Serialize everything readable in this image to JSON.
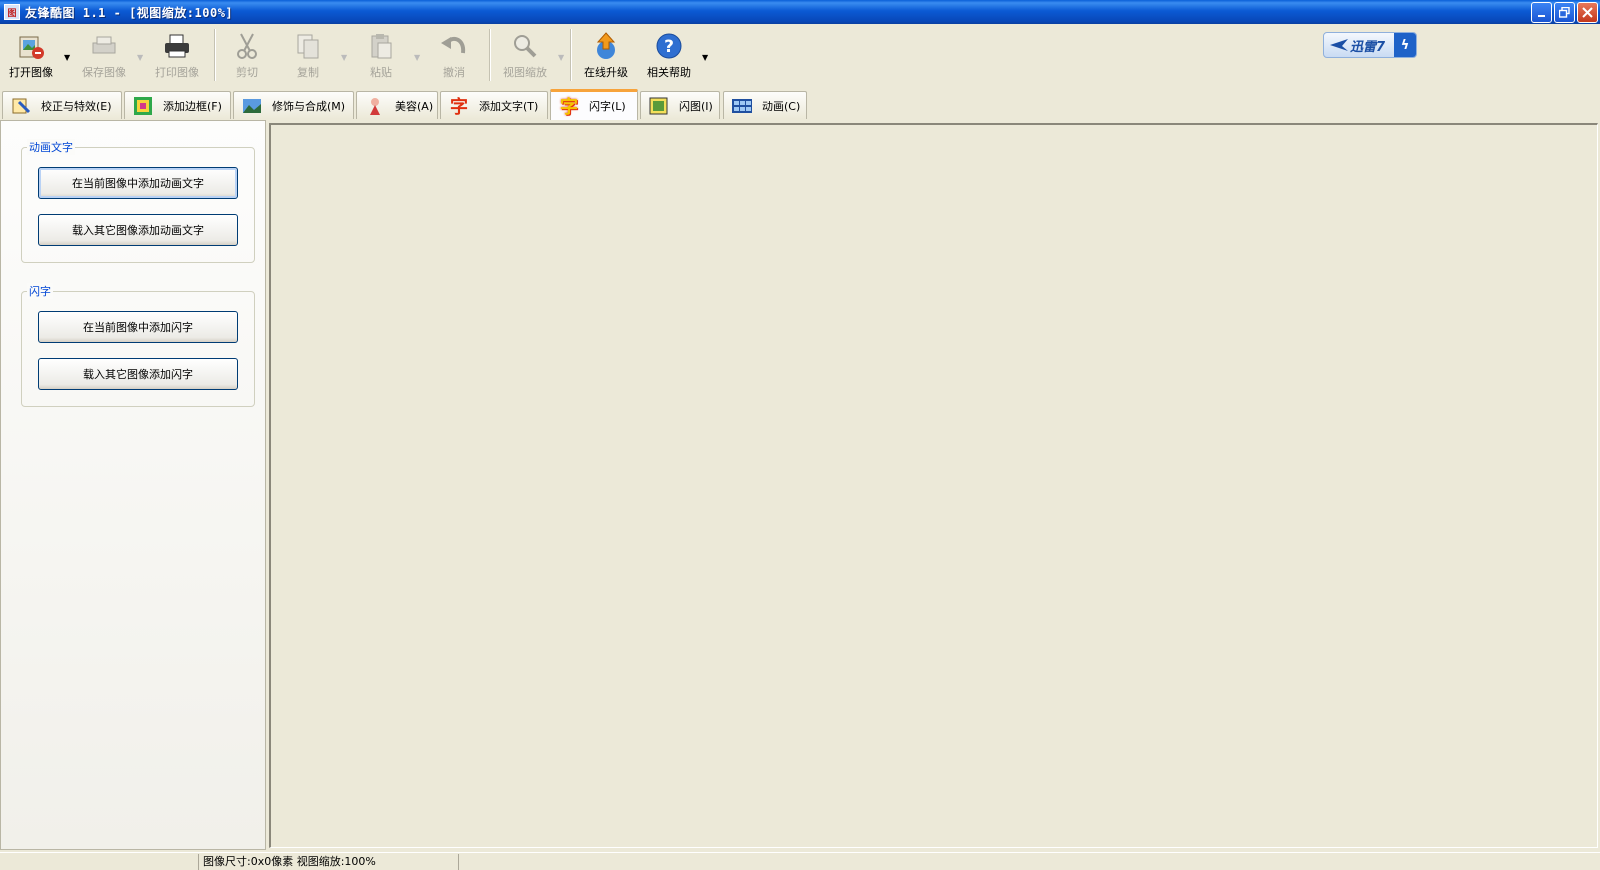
{
  "titlebar": {
    "title": "友锋酷图 1.1 - [视图缩放:100%]",
    "app_icon": "app-icon",
    "buttons": [
      "minimize",
      "restore",
      "close"
    ]
  },
  "toolbar": {
    "open": {
      "label": "打开图像",
      "icon": "open-image-icon"
    },
    "save": {
      "label": "保存图像",
      "icon": "save-image-icon"
    },
    "print": {
      "label": "打印图像",
      "icon": "printer-icon"
    },
    "cut": {
      "label": "剪切",
      "icon": "scissors-icon"
    },
    "copy": {
      "label": "复制",
      "icon": "copy-icon"
    },
    "paste": {
      "label": "粘贴",
      "icon": "paste-icon"
    },
    "undo": {
      "label": "撤消",
      "icon": "undo-icon"
    },
    "zoom": {
      "label": "视图缩放",
      "icon": "magnifier-icon"
    },
    "upgrade": {
      "label": "在线升级",
      "icon": "upgrade-icon"
    },
    "help": {
      "label": "相关帮助",
      "icon": "help-icon"
    },
    "xunlei": {
      "label": "迅雷7",
      "icon": "bolt-icon"
    }
  },
  "tabs": [
    {
      "label": "校正与特效(E)",
      "icon": "effects-icon"
    },
    {
      "label": "添加边框(F)",
      "icon": "frame-icon"
    },
    {
      "label": "修饰与合成(M)",
      "icon": "compose-icon"
    },
    {
      "label": "美容(A)",
      "icon": "beauty-icon"
    },
    {
      "label": "添加文字(T)",
      "icon": "text-icon",
      "glyph": "字"
    },
    {
      "label": "闪字(L)",
      "icon": "flash-text-icon",
      "glyph": "字",
      "active": true
    },
    {
      "label": "闪图(I)",
      "icon": "flash-image-icon"
    },
    {
      "label": "动画(C)",
      "icon": "animation-icon"
    }
  ],
  "panel": {
    "animated_group": {
      "title": "动画文字",
      "btn_current": "在当前图像中添加动画文字",
      "btn_load": "载入其它图像添加动画文字"
    },
    "flash_group": {
      "title": "闪字",
      "btn_current": "在当前图像中添加闪字",
      "btn_load": "载入其它图像添加闪字"
    }
  },
  "statusbar": {
    "info": "图像尺寸:0x0像素  视图缩放:100%"
  },
  "colors": {
    "titlebar": "#0b5ad4",
    "face": "#ece9d8",
    "group_title": "#0046d5",
    "active_tab_accent": "#f7a33b"
  }
}
